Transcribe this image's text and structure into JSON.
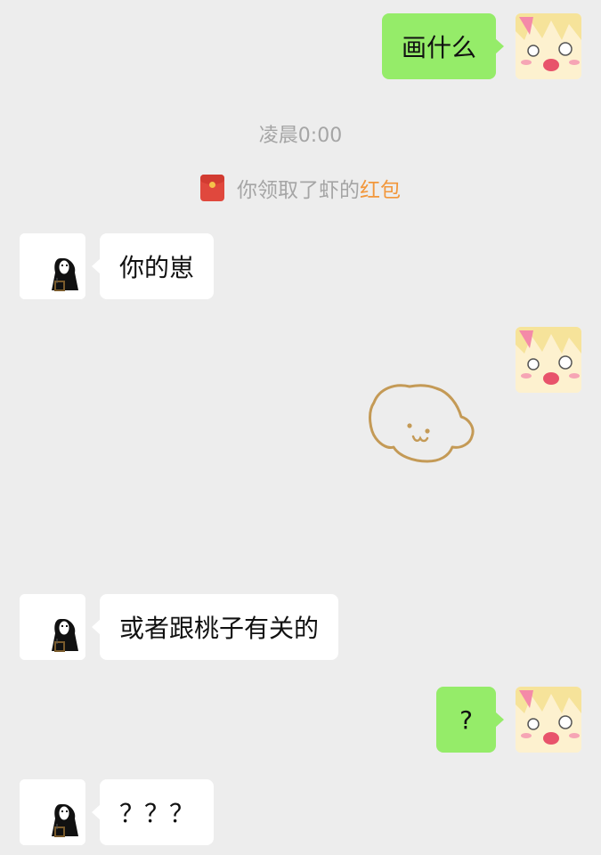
{
  "messages": [
    {
      "side": "right",
      "type": "text",
      "text": "画什么"
    },
    {
      "side": "left",
      "type": "text",
      "text": "你的崽"
    },
    {
      "side": "right",
      "type": "sticker",
      "sticker": "puppy-doodle"
    },
    {
      "side": "left",
      "type": "text",
      "text": "或者跟桃子有关的"
    },
    {
      "side": "right",
      "type": "text",
      "text": "?"
    },
    {
      "side": "left",
      "type": "text",
      "text": "？？？"
    }
  ],
  "timestamp": "凌晨0:00",
  "system_notice": {
    "icon": "red-packet-icon",
    "prefix": "你领取了虾的",
    "link": "红包"
  },
  "colors": {
    "background": "#ededed",
    "self_bubble": "#95ec69",
    "other_bubble": "#ffffff",
    "link": "#f2973b",
    "doodle_stroke": "#c49a56"
  },
  "avatars": {
    "self": "anime-girl-avatar",
    "other": "no-face-avatar"
  }
}
